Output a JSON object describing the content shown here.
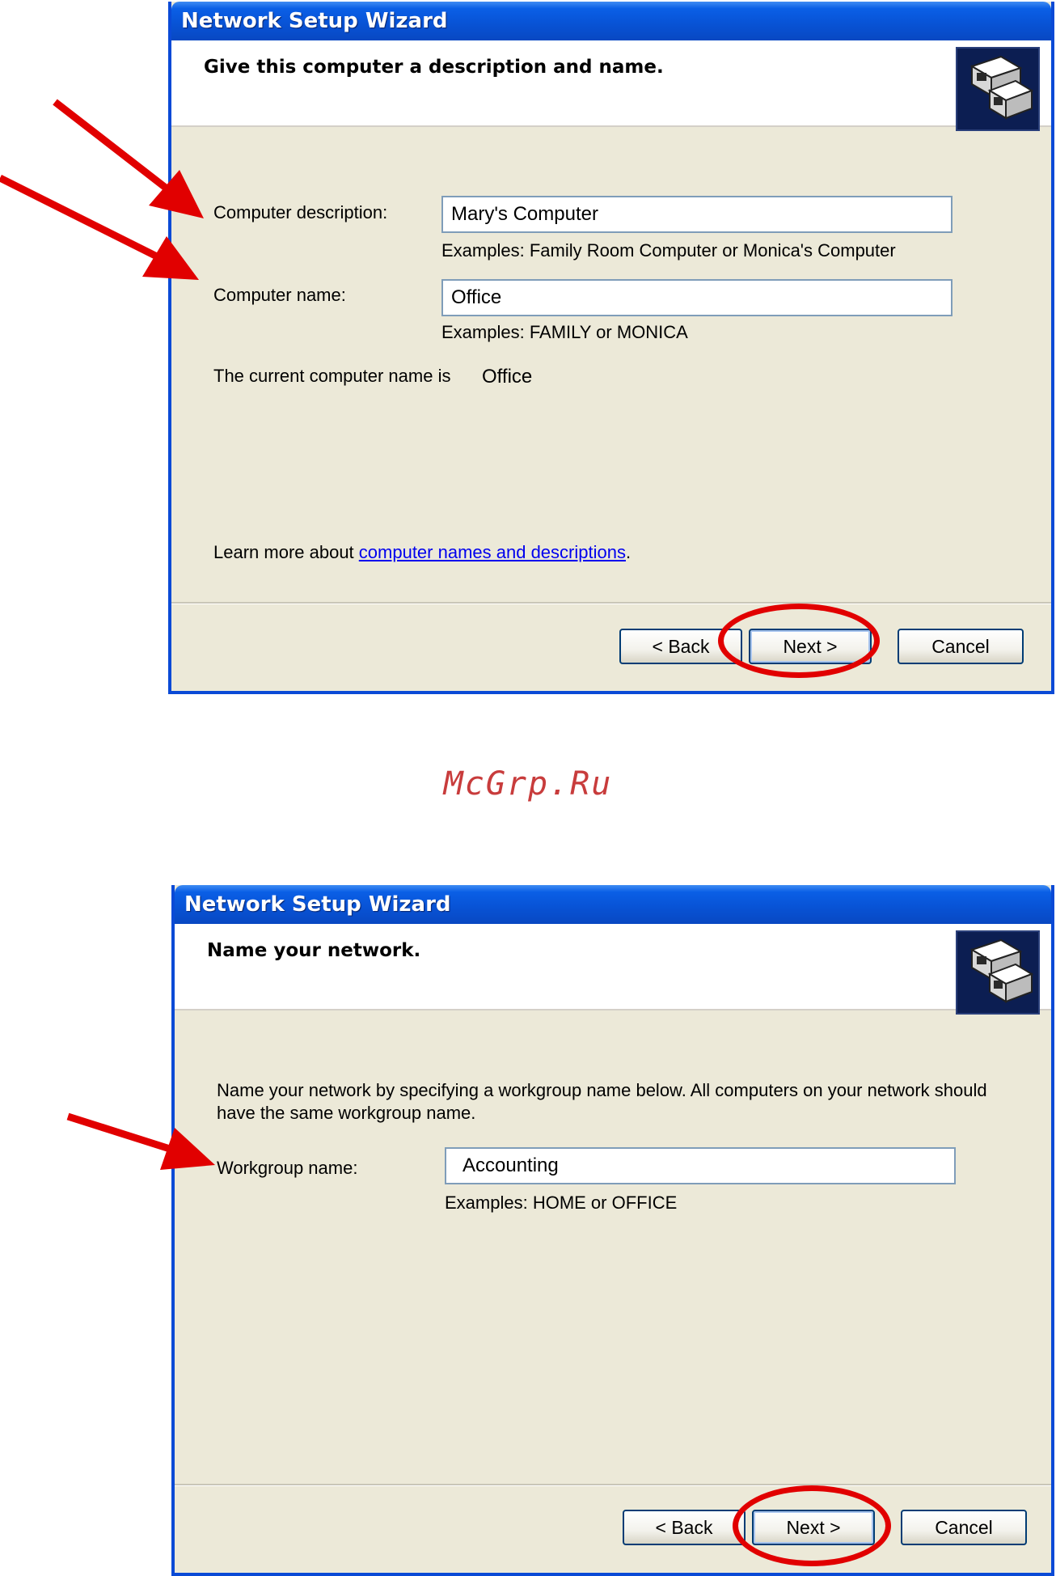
{
  "dialog1": {
    "title": "Network Setup Wizard",
    "heading": "Give this computer a description and name.",
    "icon": "network-computers-icon",
    "description_label": "Computer description:",
    "description_value": "Mary's Computer",
    "description_hint": "Examples: Family Room Computer or Monica's Computer",
    "name_label": "Computer name:",
    "name_value": "Office",
    "name_hint": "Examples: FAMILY or MONICA",
    "current_name_text": "The current computer name is",
    "current_name_value": "Office",
    "learn_more_text": "Learn more about ",
    "learn_more_link": "computer names and descriptions",
    "learn_more_end": ".",
    "back_label": "< Back",
    "next_label": "Next >",
    "cancel_label": "Cancel"
  },
  "watermark": "McGrp.Ru",
  "dialog2": {
    "title": "Network Setup Wizard",
    "heading": "Name your network.",
    "icon": "network-computers-icon",
    "intro": "Name your network by specifying a workgroup name below. All computers on your network should have the same workgroup name.",
    "workgroup_label": "Workgroup name:",
    "workgroup_value": "Accounting",
    "workgroup_hint": "Examples: HOME or OFFICE",
    "back_label": "< Back",
    "next_label": "Next >",
    "cancel_label": "Cancel"
  },
  "colors": {
    "titlebar": "#0852d4",
    "dialog_bg": "#ece9d8",
    "annotation": "#e10000",
    "watermark": "#c83c3c"
  }
}
